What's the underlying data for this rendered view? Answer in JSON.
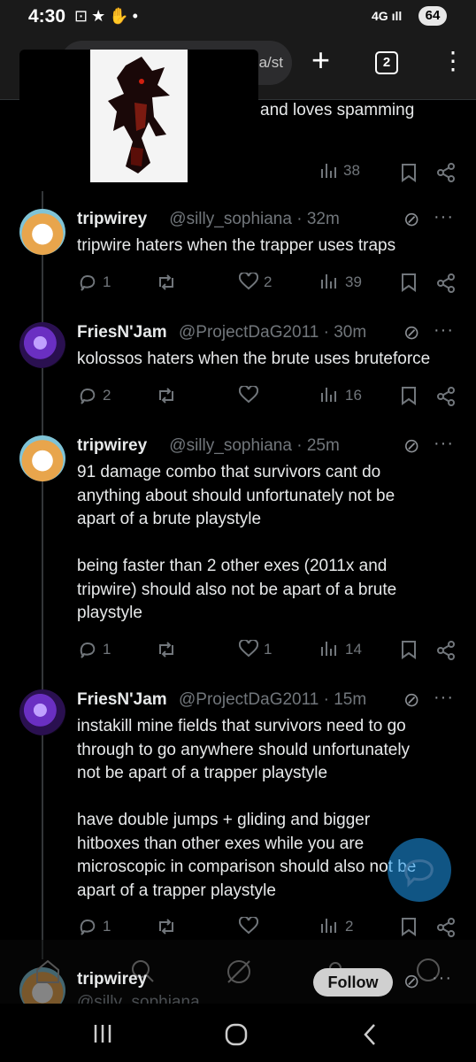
{
  "status_bar": {
    "time": "4:30",
    "left_icons": "⊡★✋•",
    "network": "4G",
    "signal": "ıll",
    "battery": "64"
  },
  "browser": {
    "url_fragment": "a/st",
    "tab_count": "2"
  },
  "header_tweet": {
    "text_fragment": "and loves spamming",
    "views": "38"
  },
  "tweets": [
    {
      "name": "tripwirey",
      "handle": "@silly_sophiana · 32m",
      "lines": [
        "tripwire haters when the trapper uses traps"
      ],
      "replies": "1",
      "reposts": "",
      "likes": "2",
      "views": "39"
    },
    {
      "name": "FriesN'Jam",
      "handle": "@ProjectDaG2011 · 30m",
      "lines": [
        "kolossos haters when the brute uses bruteforce"
      ],
      "replies": "2",
      "reposts": "",
      "likes": "",
      "views": "16"
    },
    {
      "name": "tripwirey",
      "handle": "@silly_sophiana · 25m",
      "lines": [
        "91 damage combo that survivors cant do",
        "anything about should unfortunately not be",
        "apart of a brute playstyle",
        "",
        "being faster than 2 other exes (2011x and",
        "tripwire) should also not be apart of a brute",
        "playstyle"
      ],
      "replies": "1",
      "reposts": "",
      "likes": "1",
      "views": "14"
    },
    {
      "name": "FriesN'Jam",
      "handle": "@ProjectDaG2011 · 15m",
      "lines": [
        "instakill mine fields that survivors need to go",
        "through to go anywhere should unfortunately",
        "not be apart of a trapper playstyle",
        "",
        "have double jumps + gliding and bigger",
        "hitboxes than other exes while you are",
        "microscopic in comparison should also not be",
        "apart of a trapper playstyle"
      ],
      "replies": "1",
      "reposts": "",
      "likes": "",
      "views": "2"
    }
  ],
  "next_tweet": {
    "name": "tripwirey",
    "handle": "@silly_sophiana"
  },
  "follow_label": "Follow",
  "colors": {
    "background": "#000000",
    "text": "#e7e9ea",
    "muted": "#71767b",
    "accent": "#1d9bf0"
  }
}
